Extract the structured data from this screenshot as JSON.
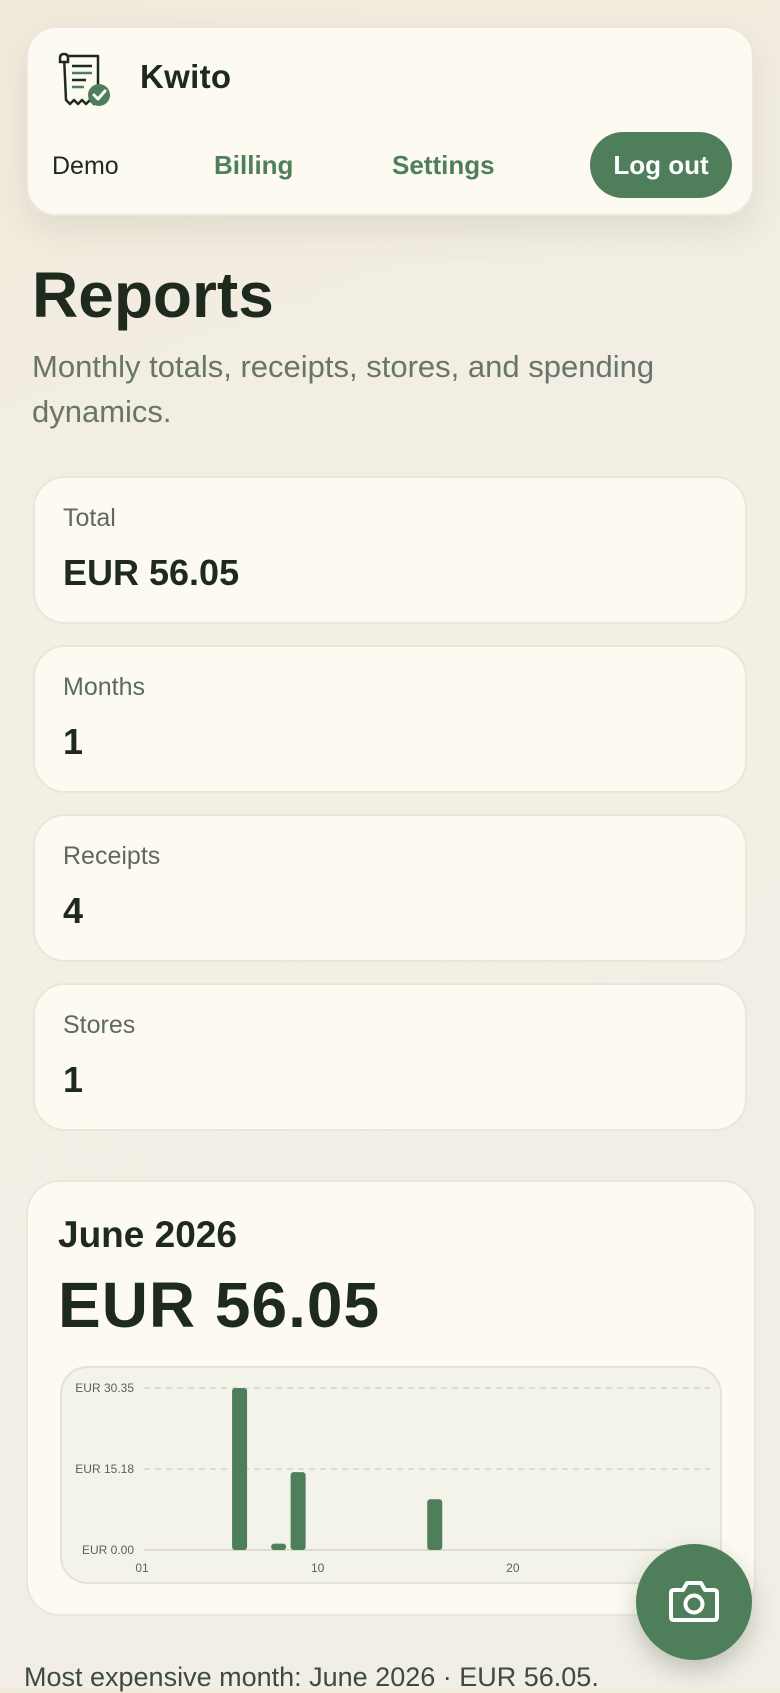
{
  "app": {
    "name": "Kwito",
    "logo_icon": "receipt-check-icon"
  },
  "nav": {
    "user": "Demo",
    "billing": "Billing",
    "settings": "Settings",
    "logout": "Log out"
  },
  "page": {
    "title": "Reports",
    "subtitle": "Monthly totals, receipts, stores, and spending dynamics."
  },
  "stats": [
    {
      "label": "Total",
      "value": "EUR 56.05"
    },
    {
      "label": "Months",
      "value": "1"
    },
    {
      "label": "Receipts",
      "value": "4"
    },
    {
      "label": "Stores",
      "value": "1"
    }
  ],
  "month": {
    "name": "June 2026",
    "total": "EUR 56.05"
  },
  "chart_data": {
    "type": "bar",
    "x": [
      6,
      8,
      9,
      16
    ],
    "values": [
      30.35,
      1.2,
      14.6,
      9.5
    ],
    "xlim": [
      1,
      30
    ],
    "ylim": [
      0,
      30.35
    ],
    "yticks": [
      {
        "value": 0,
        "label": "EUR 0.00"
      },
      {
        "value": 15.18,
        "label": "EUR 15.18"
      },
      {
        "value": 30.35,
        "label": "EUR 30.35"
      }
    ],
    "xticks": [
      {
        "value": 1,
        "label": "01"
      },
      {
        "value": 10,
        "label": "10"
      },
      {
        "value": 20,
        "label": "20"
      }
    ],
    "grid": true,
    "color": "#4f7f5a"
  },
  "fab": {
    "icon": "camera-icon"
  },
  "footer": {
    "text": "Most expensive month: June 2026 · EUR 56.05."
  },
  "colors": {
    "accent": "#4f7f5a",
    "text": "#1f2a1f",
    "card": "#fcfaf1"
  }
}
